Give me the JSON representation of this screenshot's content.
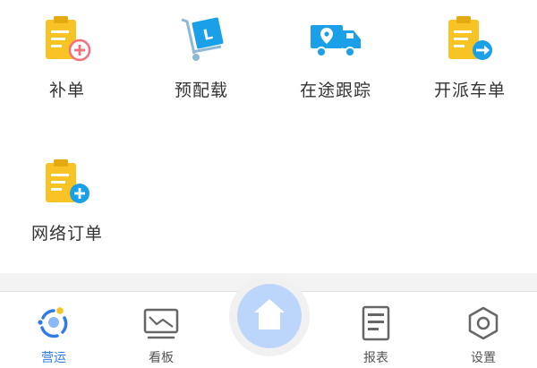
{
  "grid": {
    "items": [
      {
        "label": "补单",
        "icon": "clipboard-add-icon"
      },
      {
        "label": "预配载",
        "icon": "hand-truck-icon"
      },
      {
        "label": "在途跟踪",
        "icon": "delivery-truck-icon"
      },
      {
        "label": "开派车单",
        "icon": "clipboard-arrow-icon"
      },
      {
        "label": "网络订单",
        "icon": "clipboard-plus-icon"
      }
    ]
  },
  "tabbar": {
    "active": "营运",
    "items": [
      {
        "label": "营运",
        "icon": "operations-icon"
      },
      {
        "label": "看板",
        "icon": "dashboard-icon"
      },
      {
        "label": "",
        "icon": "home-icon"
      },
      {
        "label": "报表",
        "icon": "report-icon"
      },
      {
        "label": "设置",
        "icon": "settings-icon"
      }
    ]
  },
  "colors": {
    "accent": "#2f7ce8",
    "clipboard": "#f7c325",
    "blue_icon": "#1aa0e8",
    "badge_red": "#f2707b",
    "home_bg": "#bcd6fb"
  }
}
